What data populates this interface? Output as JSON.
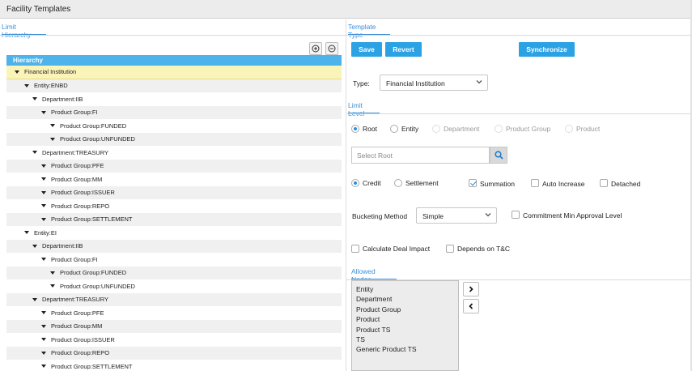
{
  "window": {
    "title": "Facility Templates"
  },
  "left": {
    "tab": "Limit Hierarchy",
    "tree_header": "Hierarchy",
    "tree": [
      {
        "label": "Financial Institution",
        "level": 0,
        "selected": true
      },
      {
        "label": "Entity:ENBD",
        "level": 1
      },
      {
        "label": "Department:IIB",
        "level": 2
      },
      {
        "label": "Product Group:FI",
        "level": 3
      },
      {
        "label": "Product Group:FUNDED",
        "level": 4
      },
      {
        "label": "Product Group:UNFUNDED",
        "level": 4
      },
      {
        "label": "Department:TREASURY",
        "level": 2
      },
      {
        "label": "Product Group:PFE",
        "level": 3
      },
      {
        "label": "Product Group:MM",
        "level": 3
      },
      {
        "label": "Product Group:ISSUER",
        "level": 3
      },
      {
        "label": "Product Group:REPO",
        "level": 3
      },
      {
        "label": "Product Group:SETTLEMENT",
        "level": 3
      },
      {
        "label": "Entity:EI",
        "level": 1
      },
      {
        "label": "Department:IIB",
        "level": 2
      },
      {
        "label": "Product Group:FI",
        "level": 3
      },
      {
        "label": "Product Group:FUNDED",
        "level": 4
      },
      {
        "label": "Product Group:UNFUNDED",
        "level": 4
      },
      {
        "label": "Department:TREASURY",
        "level": 2
      },
      {
        "label": "Product Group:PFE",
        "level": 3
      },
      {
        "label": "Product Group:MM",
        "level": 3
      },
      {
        "label": "Product Group:ISSUER",
        "level": 3
      },
      {
        "label": "Product Group:REPO",
        "level": 3
      },
      {
        "label": "Product Group:SETTLEMENT",
        "level": 3
      }
    ]
  },
  "right": {
    "tab": "Template Type",
    "save": "Save",
    "revert": "Revert",
    "synchronize": "Synchronize",
    "type_label": "Type:",
    "type_value": "Financial Institution",
    "limit_level_tab": "Limit Level",
    "levels": [
      {
        "label": "Root",
        "checked": true,
        "disabled": false
      },
      {
        "label": "Entity",
        "checked": false,
        "disabled": false
      },
      {
        "label": "Department",
        "checked": false,
        "disabled": true
      },
      {
        "label": "Product Group",
        "checked": false,
        "disabled": true
      },
      {
        "label": "Product",
        "checked": false,
        "disabled": true
      }
    ],
    "root_placeholder": "Select Root",
    "credit": "Credit",
    "settlement": "Settlement",
    "summation": "Summation",
    "auto_increase": "Auto Increase",
    "detached": "Detached",
    "bucketing_label": "Bucketing Method",
    "bucketing_value": "Simple",
    "commitment": "Commitment Min Approval Level",
    "calc_deal_impact": "Calculate Deal Impact",
    "depends_tc": "Depends on T&C",
    "allowed_nodes_tab": "Allowed Nodes",
    "allowed_nodes": [
      "Entity",
      "Department",
      "Product Group",
      "Product",
      "Product TS",
      "TS",
      "Generic Product TS"
    ]
  },
  "colors": {
    "accent": "#2aa2e4",
    "tree_header": "#4db3ea",
    "selected_row": "#fbf4b8"
  }
}
